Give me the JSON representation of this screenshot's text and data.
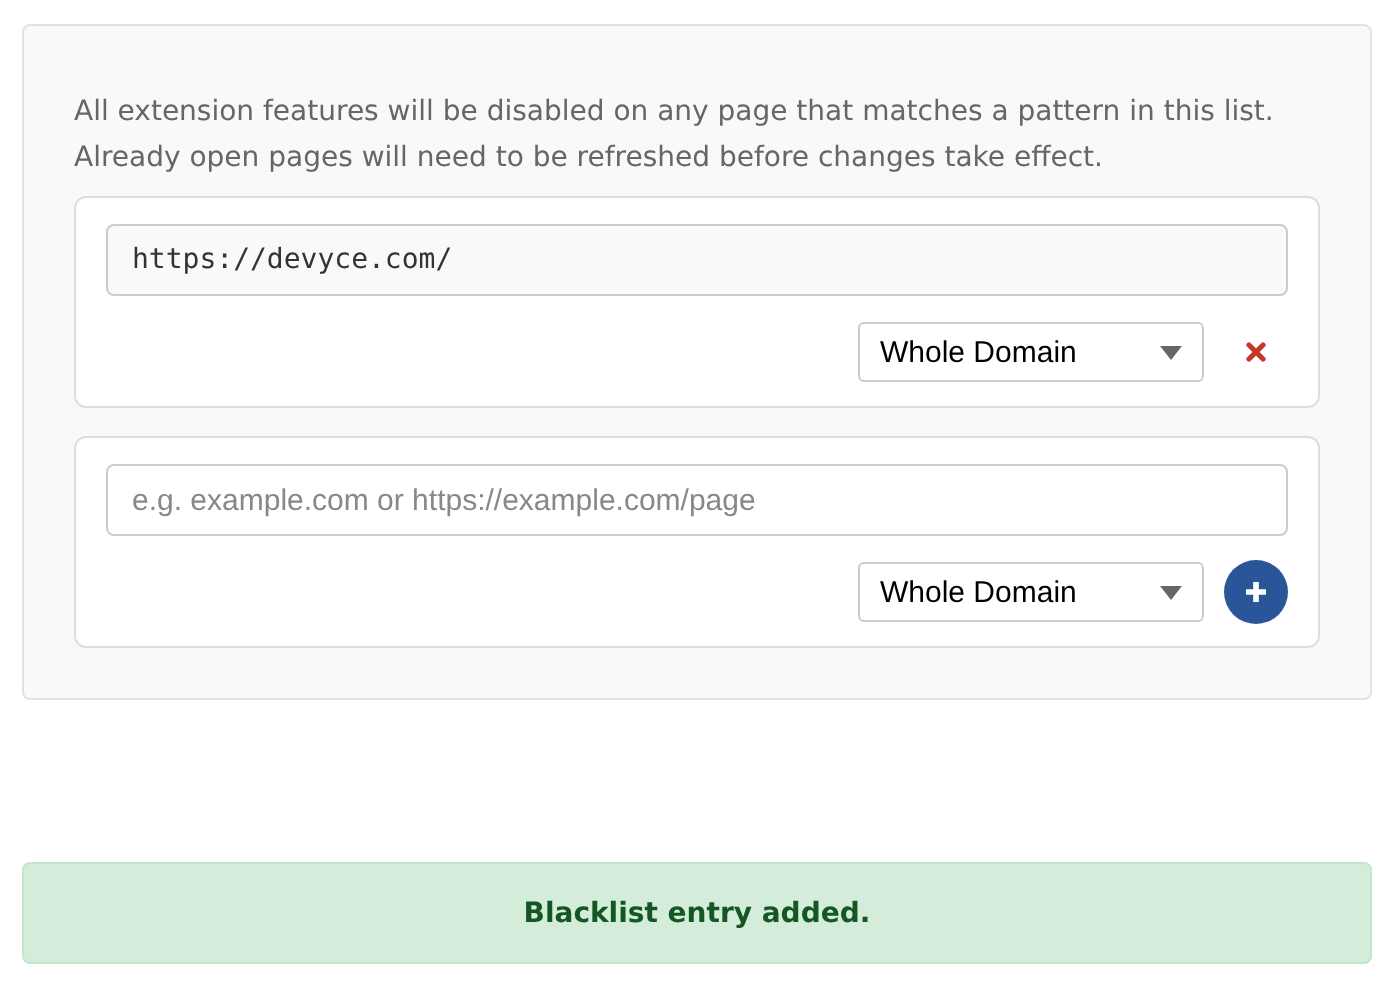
{
  "description": "All extension features will be disabled on any page that matches a pattern in this list.\nAlready open pages will need to be refreshed before changes take effect.",
  "entries": [
    {
      "kind": "existing",
      "value": "https://devyce.com/",
      "scope": "Whole Domain"
    },
    {
      "kind": "new",
      "placeholder": "e.g. example.com or https://example.com/page",
      "scope": "Whole Domain"
    }
  ],
  "alert": {
    "message": "Blacklist entry added."
  }
}
